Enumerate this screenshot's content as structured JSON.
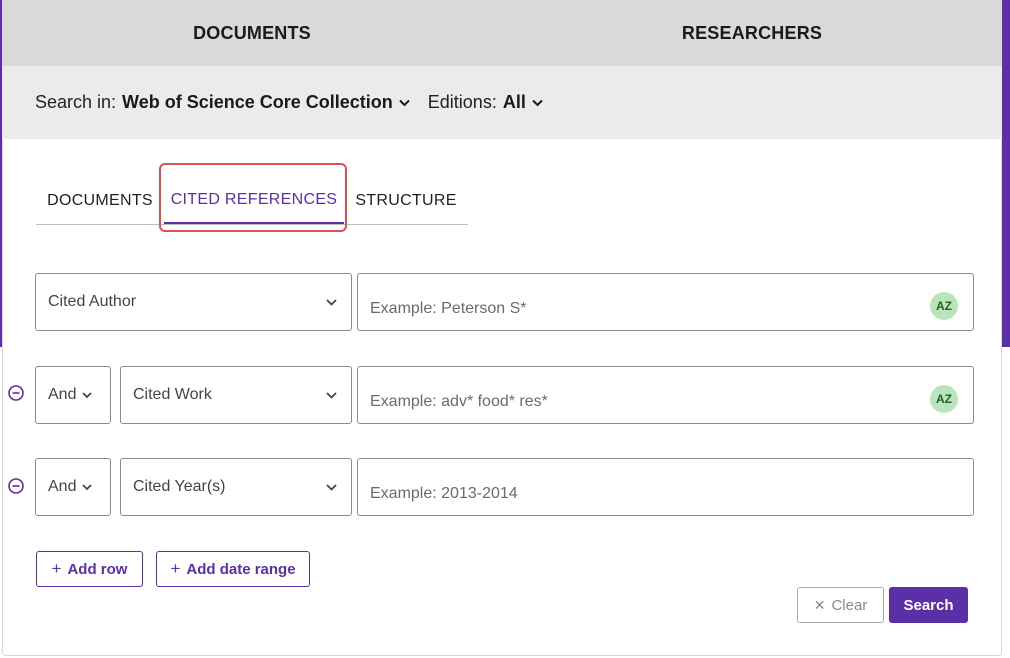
{
  "top_tabs": [
    {
      "label": "DOCUMENTS"
    },
    {
      "label": "RESEARCHERS"
    }
  ],
  "search_in": {
    "label": "Search in:",
    "collection": "Web of Science Core Collection",
    "editions_label": "Editions:",
    "editions_value": "All"
  },
  "sub_tabs": [
    {
      "label": "DOCUMENTS",
      "active": false
    },
    {
      "label": "CITED REFERENCES",
      "active": true
    },
    {
      "label": "STRUCTURE",
      "active": false
    }
  ],
  "rows": [
    {
      "field": "Cited Author",
      "placeholder": "Example: Peterson S*",
      "az": "AZ"
    },
    {
      "operator": "And",
      "field": "Cited Work",
      "placeholder": "Example: adv* food* res*",
      "az": "AZ"
    },
    {
      "operator": "And",
      "field": "Cited Year(s)",
      "placeholder": "Example: 2013-2014"
    }
  ],
  "actions": {
    "add_row": "Add row",
    "add_date_range": "Add date range",
    "clear": "Clear",
    "search": "Search"
  },
  "colors": {
    "accent": "#5b2fa8",
    "highlight": "#e05050",
    "az_badge": "#b9e6b9"
  }
}
